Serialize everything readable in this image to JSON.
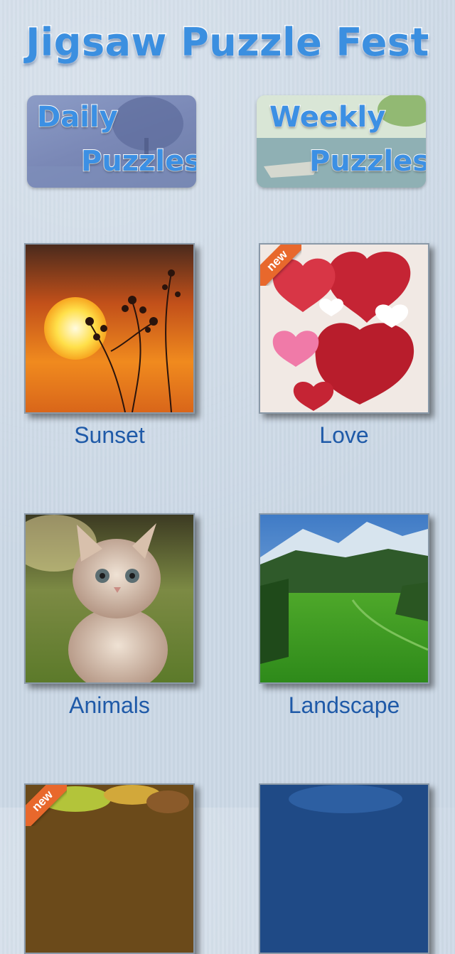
{
  "app": {
    "title": "Jigsaw Puzzle Fest"
  },
  "banners": [
    {
      "line1": "Daily",
      "line2": "Puzzles"
    },
    {
      "line1": "Weekly",
      "line2": "Puzzles"
    }
  ],
  "categories": [
    {
      "label": "Sunset",
      "badge": ""
    },
    {
      "label": "Love",
      "badge": "new"
    },
    {
      "label": "Animals",
      "badge": ""
    },
    {
      "label": "Landscape",
      "badge": ""
    },
    {
      "label": "",
      "badge": "new"
    },
    {
      "label": "",
      "badge": ""
    }
  ]
}
